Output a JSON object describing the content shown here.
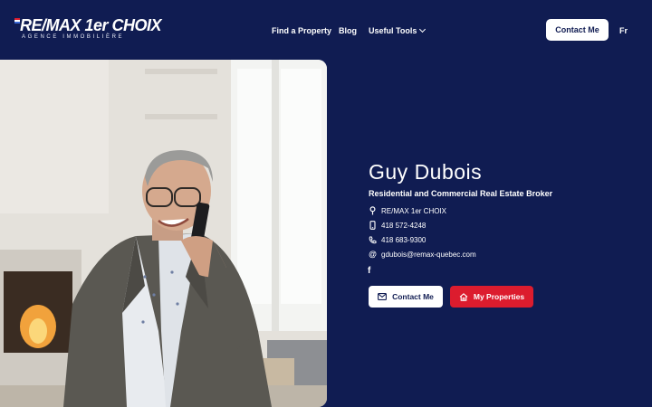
{
  "brand": {
    "logo_main": "RE/MAX 1er CHOIX",
    "logo_sub": "AGENCE IMMOBILIÈRE"
  },
  "nav": {
    "find_property": "Find a Property",
    "blog": "Blog",
    "useful_tools": "Useful Tools",
    "contact_button": "Contact Me",
    "language": "Fr"
  },
  "profile": {
    "name": "Guy Dubois",
    "title": "Residential and Commercial Real Estate Broker",
    "agency": "RE/MAX 1er CHOIX",
    "mobile": "418 572-4248",
    "phone": "418 683-9300",
    "email": "gdubois@remax-quebec.com",
    "facebook_glyph": "f"
  },
  "actions": {
    "contact_label": "Contact Me",
    "properties_label": "My Properties"
  },
  "icons": {
    "agency": "location-pin-icon",
    "mobile": "mobile-phone-icon",
    "phone": "phone-icon",
    "email": "at-sign-icon",
    "facebook": "facebook-icon",
    "contact": "envelope-icon",
    "properties": "home-icon"
  },
  "colors": {
    "background": "#101c52",
    "accent_red": "#dc1c2e",
    "white": "#ffffff"
  }
}
